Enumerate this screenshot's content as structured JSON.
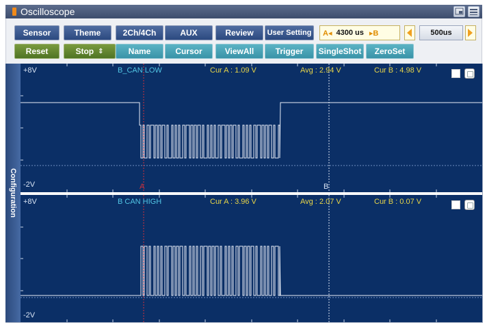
{
  "app": {
    "title": "Oscilloscope"
  },
  "toolbar": {
    "row1": [
      {
        "id": "sensor",
        "label": "Sensor"
      },
      {
        "id": "theme",
        "label": "Theme"
      },
      {
        "id": "channels",
        "label": "2Ch/4Ch"
      },
      {
        "id": "aux",
        "label": "AUX"
      },
      {
        "id": "review",
        "label": "Review"
      },
      {
        "id": "user-setting",
        "label": "User Setting"
      }
    ],
    "row2": [
      {
        "id": "reset",
        "label": "Reset"
      },
      {
        "id": "stop",
        "label": "Stop"
      },
      {
        "id": "name",
        "label": "Name"
      },
      {
        "id": "cursor",
        "label": "Cursor"
      },
      {
        "id": "viewall",
        "label": "ViewAll"
      },
      {
        "id": "trigger",
        "label": "Trigger"
      },
      {
        "id": "singleshot",
        "label": "SingleShot"
      },
      {
        "id": "zeroset",
        "label": "ZeroSet"
      }
    ],
    "cursor_span": {
      "a_tag": "A◂",
      "value": "4300 us",
      "b_tag": "▸B"
    },
    "time_div": "500us"
  },
  "side_tab": {
    "label": "Configuration"
  },
  "channels": [
    {
      "top_voltage": "+8V",
      "bottom_voltage": "-2V",
      "name": "B_CAN LOW",
      "cur_a": "Cur  A : 1.09 V",
      "avg": "Avg  : 2.94 V",
      "cur_b": "Cur  B : 4.98 V",
      "marker_a": "A",
      "marker_b": "B"
    },
    {
      "top_voltage": "+8V",
      "bottom_voltage": "-2V",
      "name": "B CAN HIGH",
      "cur_a": "Cur  A : 3.96 V",
      "avg": "Avg  : 2.07 V",
      "cur_b": "Cur  B : 0.07 V"
    }
  ],
  "colors": {
    "trace": "#e8eef8",
    "panel_bg": "#0b2f66",
    "cursor_a": "#d0303a",
    "cursor_b": "#dde6f4",
    "accent_label": "#52c6e4",
    "measure_label": "#e8d548"
  }
}
